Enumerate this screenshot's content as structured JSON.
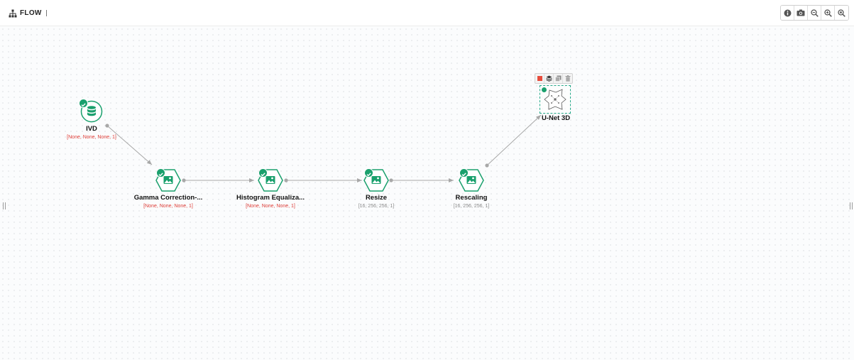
{
  "app": {
    "title": "FLOW"
  },
  "toolbar": {
    "buttons": [
      {
        "name": "info",
        "icon": "info-icon"
      },
      {
        "name": "screenshot",
        "icon": "camera-icon"
      },
      {
        "name": "zoom-out",
        "icon": "zoom-out-icon"
      },
      {
        "name": "zoom-in",
        "icon": "zoom-in-icon"
      },
      {
        "name": "zoom-fit",
        "icon": "zoom-fit-icon"
      }
    ]
  },
  "nodes": {
    "ivd": {
      "title": "IVD",
      "shape": "[None, None, None, 1]",
      "status": "ok",
      "icon": "database-icon"
    },
    "gamma": {
      "title": "Gamma Correction-...",
      "shape": "[None, None, None, 1]",
      "status": "ok",
      "icon": "image-icon"
    },
    "histogram": {
      "title": "Histogram Equaliza...",
      "shape": "[None, None, None, 1]",
      "status": "ok",
      "icon": "image-icon"
    },
    "resize": {
      "title": "Resize",
      "shape": "[16, 256, 256, 1]",
      "status": "ok",
      "icon": "image-icon"
    },
    "rescaling": {
      "title": "Rescaling",
      "shape": "[16, 256, 256, 1]",
      "status": "ok",
      "icon": "image-icon"
    },
    "unet": {
      "title": "U-Net 3D",
      "shape": "",
      "status": "selected",
      "icon": "network-icon"
    }
  },
  "node_toolbar": {
    "buttons": [
      {
        "name": "stop",
        "icon": "stop-icon"
      },
      {
        "name": "layers",
        "icon": "layers-icon"
      },
      {
        "name": "copy",
        "icon": "copy-icon"
      },
      {
        "name": "delete",
        "icon": "trash-icon"
      }
    ]
  },
  "colors": {
    "accent": "#1aa06d",
    "error_text": "#e0403a",
    "muted_text": "#8a8a8a",
    "edge": "#a8a8a8",
    "stop": "#e74c3c"
  }
}
